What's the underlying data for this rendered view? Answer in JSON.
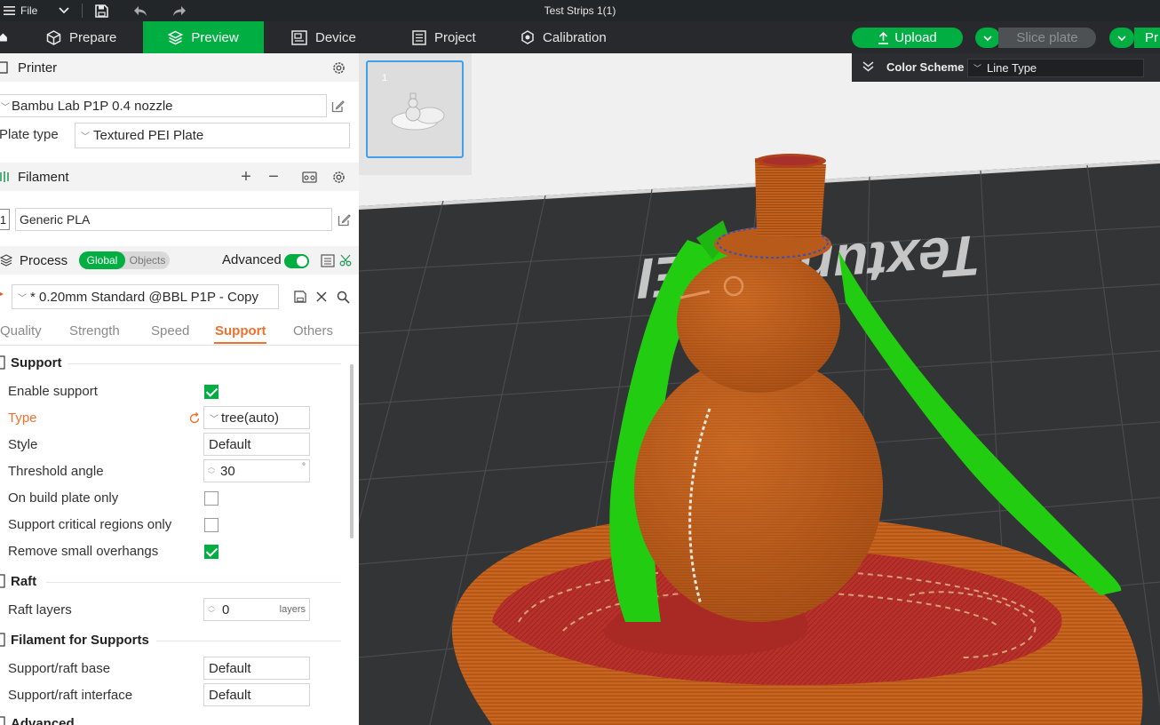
{
  "titlebar": {
    "file_label": "File",
    "window_title": "Test Strips 1(1)"
  },
  "nav": {
    "tabs": [
      {
        "label": "Prepare"
      },
      {
        "label": "Preview"
      },
      {
        "label": "Device"
      },
      {
        "label": "Project"
      },
      {
        "label": "Calibration"
      }
    ],
    "upload_label": "Upload",
    "slice_label": "Slice plate",
    "print_label_partial": "Pr"
  },
  "printer": {
    "section_title": "Printer",
    "name": "Bambu Lab P1P 0.4 nozzle",
    "plate_type_label": "Plate type",
    "plate_type_value": "Textured PEI Plate"
  },
  "filament": {
    "section_title": "Filament",
    "slot_number": "1",
    "material": "Generic PLA"
  },
  "process": {
    "section_title": "Process",
    "global_label": "Global",
    "objects_label": "Objects",
    "advanced_label": "Advanced",
    "advanced_on": true,
    "preset": "* 0.20mm Standard @BBL P1P - Copy",
    "tabs": [
      "Quality",
      "Strength",
      "Speed",
      "Support",
      "Others"
    ],
    "active_tab": "Support"
  },
  "support": {
    "group_title": "Support",
    "enable_label": "Enable support",
    "enable_checked": true,
    "type_label": "Type",
    "type_value": "tree(auto)",
    "style_label": "Style",
    "style_value": "Default",
    "threshold_label": "Threshold angle",
    "threshold_value": "30",
    "threshold_unit": "°",
    "build_plate_label": "On build plate only",
    "build_plate_checked": false,
    "critical_label": "Support critical regions only",
    "critical_checked": false,
    "overhangs_label": "Remove small overhangs",
    "overhangs_checked": true
  },
  "raft": {
    "group_title": "Raft",
    "layers_label": "Raft layers",
    "layers_value": "0",
    "layers_unit": "layers"
  },
  "filament_supports": {
    "group_title": "Filament for Supports",
    "base_label": "Support/raft base",
    "base_value": "Default",
    "interface_label": "Support/raft interface",
    "interface_value": "Default"
  },
  "advanced_group": {
    "group_title": "Advanced"
  },
  "viewport": {
    "plate_number": "1",
    "plate_text": "Textured PEI",
    "color_scheme_label": "Color Scheme",
    "color_scheme_value": "Line Type"
  },
  "colors": {
    "accent_green": "#00ae42",
    "support_green": "#22cc11",
    "wall_orange": "#c9601c",
    "inner_red": "#c0302a",
    "active_subtab": "#f0702e",
    "bed_dark": "#333436",
    "titlebar": "#232629",
    "navbar": "#27292c"
  }
}
